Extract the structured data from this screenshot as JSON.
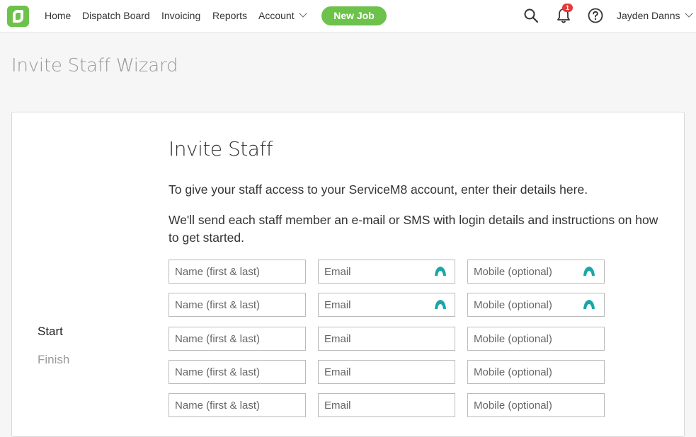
{
  "nav": {
    "home": "Home",
    "dispatch_board": "Dispatch Board",
    "invoicing": "Invoicing",
    "reports": "Reports",
    "account": "Account",
    "new_job": "New Job",
    "notification_count": "1",
    "user_name": "Jayden Danns"
  },
  "page": {
    "title": "Invite Staff Wizard"
  },
  "steps": [
    "Start",
    "Finish"
  ],
  "form": {
    "heading": "Invite Staff",
    "intro": "To give your staff access to your ServiceM8 account, enter their details here.",
    "instructions": "We'll send each staff member an e-mail or SMS with login details and instructions on how to get started.",
    "placeholders": {
      "name": "Name (first & last)",
      "email": "Email",
      "mobile": "Mobile (optional)"
    }
  },
  "colors": {
    "brand_green": "#6cc24a",
    "badge_red": "#e33b3b",
    "autofill_teal": "#1aa6a6"
  }
}
